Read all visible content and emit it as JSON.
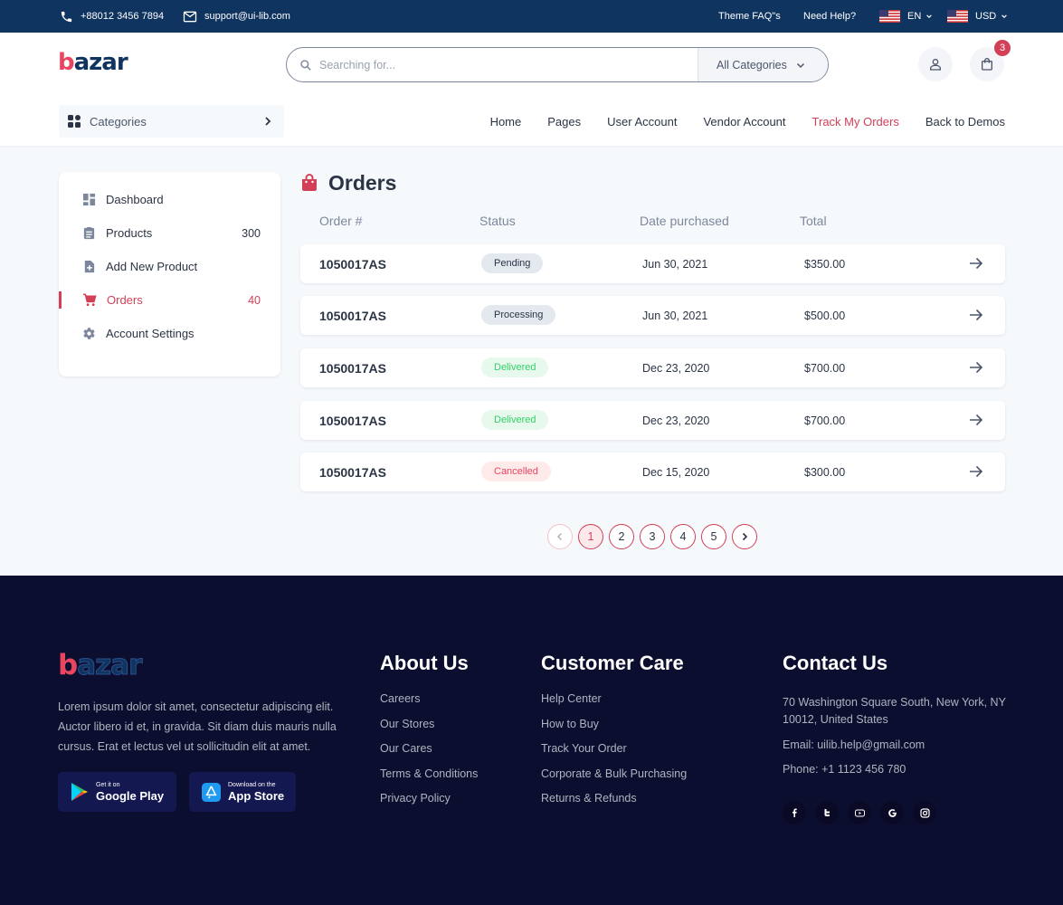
{
  "topbar": {
    "phone": "+88012 3456 7894",
    "email": "support@ui-lib.com",
    "faq": "Theme FAQ\"s",
    "help": "Need Help?",
    "language": "EN",
    "currency": "USD"
  },
  "brand": {
    "logo_b": "b",
    "logo_rest": "azar"
  },
  "search": {
    "placeholder": "Searching for...",
    "category": "All Categories"
  },
  "cart": {
    "count": "3"
  },
  "categories_button": "Categories",
  "nav": [
    {
      "label": "Home"
    },
    {
      "label": "Pages"
    },
    {
      "label": "User Account"
    },
    {
      "label": "Vendor Account"
    },
    {
      "label": "Track My Orders",
      "active": true
    },
    {
      "label": "Back to Demos"
    }
  ],
  "sidebar": {
    "items": [
      {
        "label": "Dashboard",
        "icon": "dashboard-icon",
        "count": ""
      },
      {
        "label": "Products",
        "icon": "assignment-icon",
        "count": "300"
      },
      {
        "label": "Add New Product",
        "icon": "add-file-icon",
        "count": ""
      },
      {
        "label": "Orders",
        "icon": "cart-icon",
        "count": "40",
        "active": true
      },
      {
        "label": "Account Settings",
        "icon": "gear-icon",
        "count": ""
      }
    ]
  },
  "orders": {
    "title": "Orders",
    "columns": [
      "Order #",
      "Status",
      "Date purchased",
      "Total"
    ],
    "rows": [
      {
        "id": "1050017AS",
        "status": "Pending",
        "date": "Jun 30, 2021",
        "total": "$350.00"
      },
      {
        "id": "1050017AS",
        "status": "Processing",
        "date": "Jun 30, 2021",
        "total": "$500.00"
      },
      {
        "id": "1050017AS",
        "status": "Delivered",
        "date": "Dec 23, 2020",
        "total": "$700.00"
      },
      {
        "id": "1050017AS",
        "status": "Delivered",
        "date": "Dec 23, 2020",
        "total": "$700.00"
      },
      {
        "id": "1050017AS",
        "status": "Cancelled",
        "date": "Dec 15, 2020",
        "total": "$300.00"
      }
    ]
  },
  "pagination": {
    "pages": [
      "1",
      "2",
      "3",
      "4",
      "5"
    ],
    "current": "1"
  },
  "footer": {
    "description": "Lorem ipsum dolor sit amet, consectetur adipiscing elit. Auctor libero id et, in gravida. Sit diam duis mauris nulla cursus. Erat et lectus vel ut sollicitudin elit at amet.",
    "google_play": {
      "small": "Get it on",
      "big": "Google Play"
    },
    "app_store": {
      "small": "Download on the",
      "big": "App Store"
    },
    "about": {
      "title": "About Us",
      "links": [
        "Careers",
        "Our Stores",
        "Our Cares",
        "Terms & Conditions",
        "Privacy Policy"
      ]
    },
    "care": {
      "title": "Customer Care",
      "links": [
        "Help Center",
        "How to Buy",
        "Track Your Order",
        "Corporate & Bulk Purchasing",
        "Returns & Refunds"
      ]
    },
    "contact": {
      "title": "Contact Us",
      "address": "70 Washington Square South, New York, NY 10012, United States",
      "email": "Email: uilib.help@gmail.com",
      "phone": "Phone: +1 1123 456 780"
    },
    "social": [
      "facebook-icon",
      "twitter-icon",
      "youtube-icon",
      "google-icon",
      "instagram-icon"
    ]
  },
  "colors": {
    "primary": "#d23f57",
    "navy": "#0f3460",
    "footer_bg": "#0c0e30"
  }
}
